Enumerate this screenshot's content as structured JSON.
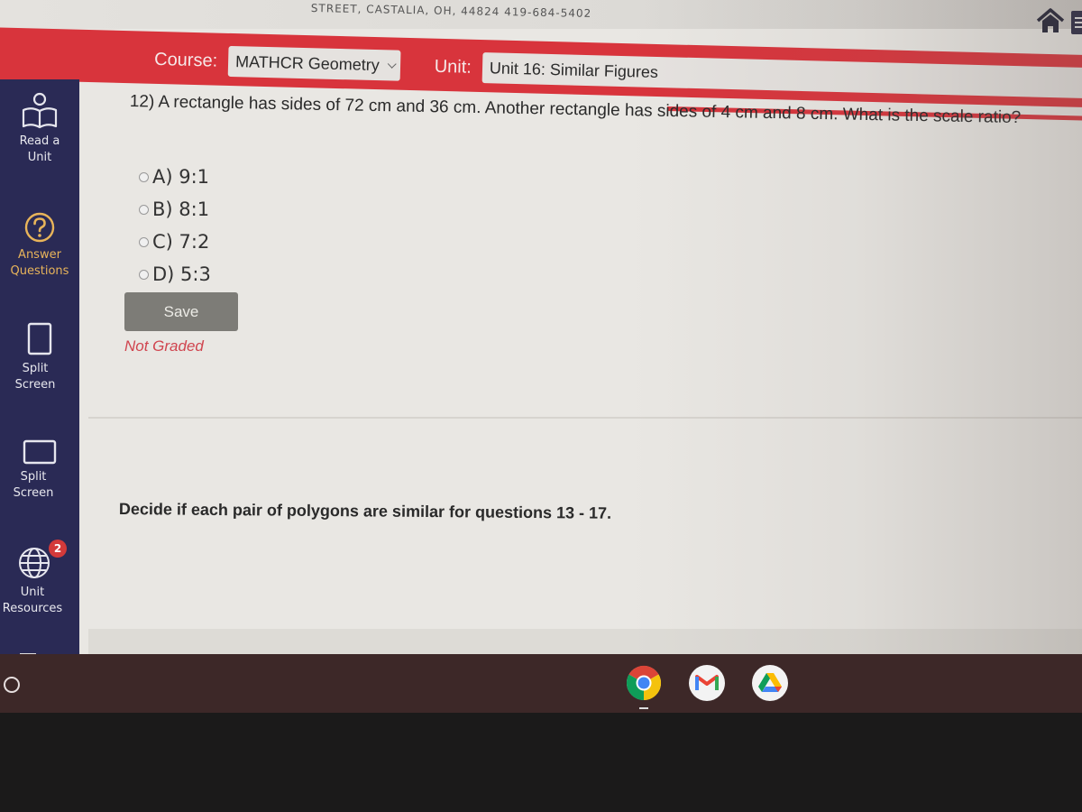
{
  "header": {
    "address_text": "STREET, CASTALIA, OH, 44824   419-684-5402",
    "home_icon": "home-icon",
    "menu_icon": "menu-icon"
  },
  "banner": {
    "course_label": "Course:",
    "course_value": "MATHCR Geometry",
    "unit_label": "Unit:",
    "unit_value": "Unit 16: Similar Figures"
  },
  "sidebar": {
    "items": [
      {
        "label_line1": "Read a",
        "label_line2": "Unit",
        "icon": "book-reader-icon",
        "active": false
      },
      {
        "label_line1": "Answer",
        "label_line2": "Questions",
        "icon": "question-circle-icon",
        "active": true
      },
      {
        "label_line1": "Split",
        "label_line2": "Screen",
        "icon": "split-screen-portrait-icon",
        "active": false
      },
      {
        "label_line1": "Split",
        "label_line2": "Screen",
        "icon": "split-screen-landscape-icon",
        "active": false
      },
      {
        "label_line1": "Unit",
        "label_line2": "Resources",
        "icon": "globe-icon",
        "badge": "2",
        "active": false
      }
    ]
  },
  "question": {
    "text": "12) A rectangle has sides of 72 cm and 36 cm. Another rectangle has sides of 4 cm and 8 cm. What is the scale ratio?",
    "options": [
      {
        "label": "A) 9:1",
        "selected": false
      },
      {
        "label": "B) 8:1",
        "selected": false
      },
      {
        "label": "C) 7:2",
        "selected": false
      },
      {
        "label": "D) 5:3",
        "selected": false
      }
    ],
    "save_label": "Save",
    "status": "Not Graded"
  },
  "instructions": "Decide if each pair of polygons are similar for questions 13 - 17.",
  "shelf": {
    "apps": [
      "Chrome",
      "Gmail",
      "Google Drive"
    ]
  },
  "colors": {
    "banner_red": "#d8343c",
    "sidebar_navy": "#2a2a55",
    "active_gold": "#e8b45a",
    "status_red": "#d0454f",
    "badge_red": "#d33a3a"
  }
}
